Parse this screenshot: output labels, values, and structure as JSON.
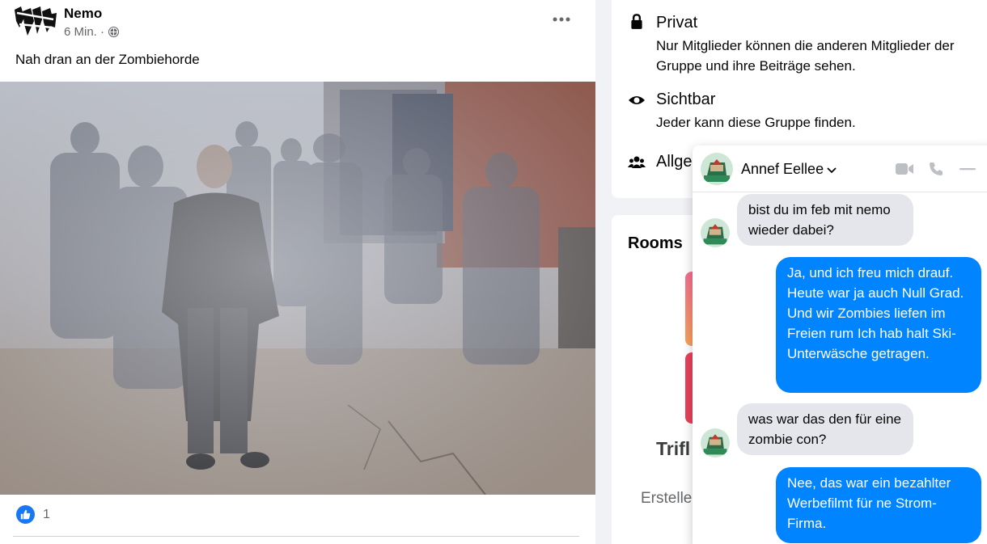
{
  "post": {
    "author": "Nemo",
    "time": "6 Min. ·",
    "text": "Nah dran an der Zombiehorde",
    "like_count": "1"
  },
  "group_info": {
    "privacy_title": "Privat",
    "privacy_desc": "Nur Mitglieder können die anderen Mitglieder der Gruppe und ihre Beiträge sehen.",
    "visibility_title": "Sichtbar",
    "visibility_desc": "Jeder kann diese Gruppe finden.",
    "general_title": "Allge"
  },
  "rooms": {
    "title": "Rooms",
    "partial_heading": "Trifl",
    "partial_text": "Erstelle"
  },
  "chat": {
    "name": "Annef Eellee",
    "messages": [
      {
        "dir": "in",
        "text": "bist du im feb mit nemo wieder dabei?"
      },
      {
        "dir": "out",
        "text": "Ja, und ich freu mich drauf. Heute war ja auch Null Grad. Und wir Zombies liefen im Freien rum Ich hab halt Ski-Unterwäsche getragen."
      },
      {
        "dir": "in",
        "text": "was war das den für eine zombie con?"
      },
      {
        "dir": "out",
        "text": "Nee, das war ein bezahlter Werbefilmt für ne Strom-Firma."
      }
    ]
  },
  "colors": {
    "accent": "#1877f2",
    "messenger_blue": "#0084ff",
    "bubble_gray": "#e4e6eb"
  },
  "icons": [
    "more-horizontal-icon",
    "globe-icon",
    "like-icon",
    "lock-icon",
    "eye-icon",
    "group-icon",
    "video-call-icon",
    "phone-icon",
    "minimize-icon",
    "chevron-down-icon"
  ]
}
